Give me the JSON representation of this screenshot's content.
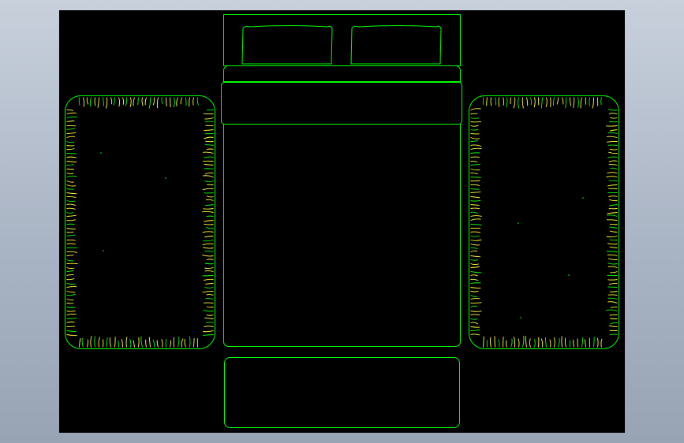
{
  "drawing": {
    "background_color": "#000000",
    "viewport_color": "#b4bdcb",
    "line_color": "#00ff00",
    "fringe_color": "#ffff33",
    "objects": [
      "bed-frame",
      "headboard",
      "pillow-left",
      "pillow-right",
      "folded-blanket",
      "mattress",
      "bench",
      "rug-left",
      "rug-right"
    ]
  }
}
